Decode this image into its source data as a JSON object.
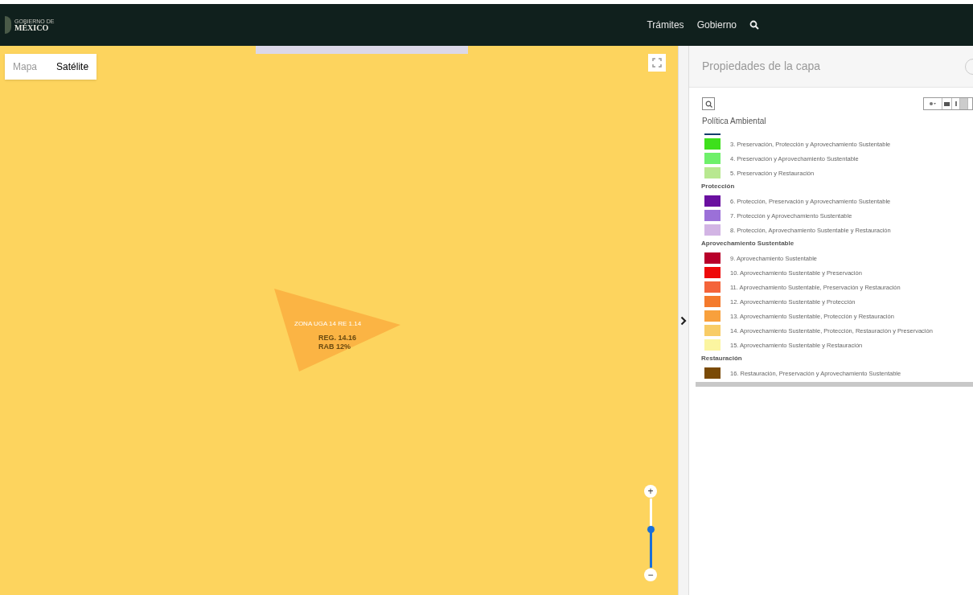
{
  "header": {
    "logo_small": "GOBIERNO DE",
    "logo_big": "MÉXICO",
    "nav": [
      "Trámites",
      "Gobierno"
    ]
  },
  "map": {
    "tabs": [
      {
        "label": "Mapa",
        "selected": false
      },
      {
        "label": "Satélite",
        "selected": true
      }
    ],
    "zone_label": "ZONA UGA 14 RE 1.14",
    "zone_lines": [
      "REG. 14.16",
      "RAB 12%"
    ],
    "zoom": {
      "plus": "+",
      "minus": "−",
      "level": 0.55
    }
  },
  "panel": {
    "title": "Propiedades de la capa",
    "layer": "Política Ambiental",
    "sections": [
      {
        "items": [
          {
            "label": "3. Preservación, Protección y Aprovechamiento Sustentable",
            "color": "#3ee01c"
          },
          {
            "label": "4. Preservación y Aprovechamiento Sustentable",
            "color": "#6ef06a"
          },
          {
            "label": "5. Preservación y Restauración",
            "color": "#b8e890"
          }
        ]
      },
      {
        "heading": "Protección",
        "items": [
          {
            "label": "6. Protección, Preservación y Aprovechamiento Sustentable",
            "color": "#6a10a0"
          },
          {
            "label": "7. Protección y Aprovechamiento Sustentable",
            "color": "#9b70d8"
          },
          {
            "label": "8. Protección, Aprovechamiento Sustentable y Restauración",
            "color": "#d2b4e4"
          }
        ]
      },
      {
        "heading": "Aprovechamiento Sustentable",
        "items": [
          {
            "label": "9. Aprovechamiento Sustentable",
            "color": "#b8002a"
          },
          {
            "label": "10. Aprovechamiento Sustentable y Preservación",
            "color": "#ee0a0a"
          },
          {
            "label": "11. Aprovechamiento Sustentable, Preservación y Restauración",
            "color": "#f4643a"
          },
          {
            "label": "12. Aprovechamiento Sustentable y Protección",
            "color": "#f47a2c"
          },
          {
            "label": "13. Aprovechamiento Sustentable, Protección y Restauración",
            "color": "#f8a03c"
          },
          {
            "label": "14. Aprovechamiento Sustentable, Protección, Restauración y Preservación",
            "color": "#f8cc66"
          },
          {
            "label": "15. Aprovechamiento Sustentable y Restauración",
            "color": "#fbf5a0"
          }
        ]
      },
      {
        "heading": "Restauración",
        "items": [
          {
            "label": "16. Restauración, Preservación y Aprovechamiento Sustentable",
            "color": "#7a4a06"
          }
        ]
      }
    ]
  }
}
